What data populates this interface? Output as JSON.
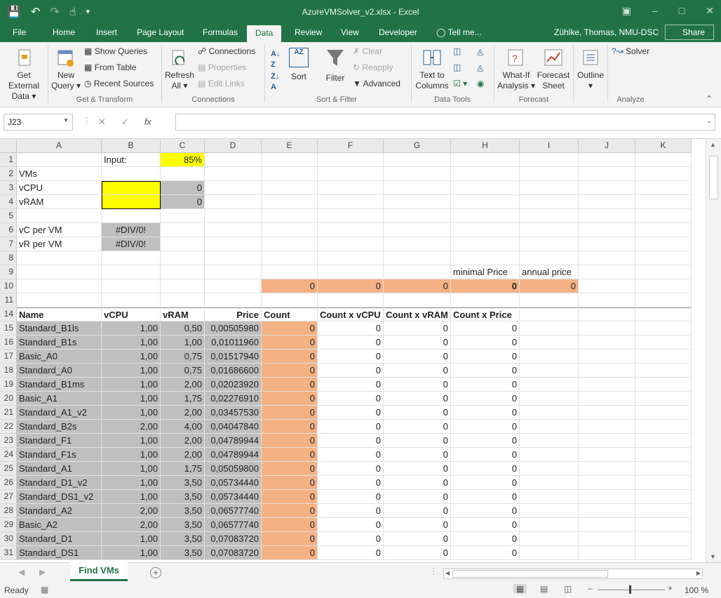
{
  "window": {
    "title": "AzureVMSolver_v2.xlsx - Excel"
  },
  "tabs": [
    "File",
    "Home",
    "Insert",
    "Page Layout",
    "Formulas",
    "Data",
    "Review",
    "View",
    "Developer"
  ],
  "active_tab": "Data",
  "tell_me": "Tell me...",
  "user": "Zühlke, Thomas, NMU-DSC",
  "share": "Share",
  "ribbon": {
    "get_external_data": [
      "Get External",
      "Data"
    ],
    "new_query": [
      "New",
      "Query"
    ],
    "show_queries": "Show Queries",
    "from_table": "From Table",
    "recent_sources": "Recent Sources",
    "refresh_all": [
      "Refresh",
      "All"
    ],
    "connections": "Connections",
    "properties": "Properties",
    "edit_links": "Edit Links",
    "sort_az": "AZ",
    "sort": "Sort",
    "filter": "Filter",
    "clear": "Clear",
    "reapply": "Reapply",
    "advanced": "Advanced",
    "text_to_columns": [
      "Text to",
      "Columns"
    ],
    "what_if": [
      "What-If",
      "Analysis"
    ],
    "forecast_sheet": [
      "Forecast",
      "Sheet"
    ],
    "outline": "Outline",
    "solver": "Solver",
    "groups": [
      "Get & Transform",
      "Connections",
      "Sort & Filter",
      "Data Tools",
      "Forecast",
      "Analyze"
    ]
  },
  "formula_bar": {
    "name_box": "J23",
    "fx": "fx",
    "formula": ""
  },
  "columns": [
    "A",
    "B",
    "C",
    "D",
    "E",
    "F",
    "G",
    "H",
    "I",
    "J",
    "K"
  ],
  "rows_top": [
    {
      "n": "1",
      "B": "Input:",
      "C": "85%"
    },
    {
      "n": "2",
      "A": "VMs"
    },
    {
      "n": "3",
      "A": "vCPU",
      "C": "0"
    },
    {
      "n": "4",
      "A": "vRAM",
      "C": "0"
    },
    {
      "n": "5"
    },
    {
      "n": "6",
      "A": "vC per VM",
      "B": "#DIV/0!"
    },
    {
      "n": "7",
      "A": "vR per VM",
      "B": "#DIV/0!"
    },
    {
      "n": "8"
    },
    {
      "n": "9",
      "H": "minimal Price",
      "I": "annual price"
    },
    {
      "n": "10",
      "E": "0",
      "F": "0",
      "G": "0",
      "H": "0",
      "I": "0"
    },
    {
      "n": "11"
    }
  ],
  "table_header": {
    "n": "14",
    "A": "Name",
    "B": "vCPU",
    "C": "vRAM",
    "D": "Price",
    "E": "Count",
    "F": "Count x vCPU",
    "G": "Count x vRAM",
    "H": "Count x Price"
  },
  "table_rows": [
    {
      "n": "15",
      "name": "Standard_B1ls",
      "vcpu": "1,00",
      "vram": "0,50",
      "price": "0,00505980",
      "count": "0",
      "cv": "0",
      "cr": "0",
      "cp": "0"
    },
    {
      "n": "16",
      "name": "Standard_B1s",
      "vcpu": "1,00",
      "vram": "1,00",
      "price": "0,01011960",
      "count": "0",
      "cv": "0",
      "cr": "0",
      "cp": "0"
    },
    {
      "n": "17",
      "name": "Basic_A0",
      "vcpu": "1,00",
      "vram": "0,75",
      "price": "0,01517940",
      "count": "0",
      "cv": "0",
      "cr": "0",
      "cp": "0"
    },
    {
      "n": "18",
      "name": "Standard_A0",
      "vcpu": "1,00",
      "vram": "0,75",
      "price": "0,01686600",
      "count": "0",
      "cv": "0",
      "cr": "0",
      "cp": "0"
    },
    {
      "n": "19",
      "name": "Standard_B1ms",
      "vcpu": "1,00",
      "vram": "2,00",
      "price": "0,02023920",
      "count": "0",
      "cv": "0",
      "cr": "0",
      "cp": "0"
    },
    {
      "n": "20",
      "name": "Basic_A1",
      "vcpu": "1,00",
      "vram": "1,75",
      "price": "0,02276910",
      "count": "0",
      "cv": "0",
      "cr": "0",
      "cp": "0"
    },
    {
      "n": "21",
      "name": "Standard_A1_v2",
      "vcpu": "1,00",
      "vram": "2,00",
      "price": "0,03457530",
      "count": "0",
      "cv": "0",
      "cr": "0",
      "cp": "0"
    },
    {
      "n": "22",
      "name": "Standard_B2s",
      "vcpu": "2,00",
      "vram": "4,00",
      "price": "0,04047840",
      "count": "0",
      "cv": "0",
      "cr": "0",
      "cp": "0"
    },
    {
      "n": "23",
      "name": "Standard_F1",
      "vcpu": "1,00",
      "vram": "2,00",
      "price": "0,04789944",
      "count": "0",
      "cv": "0",
      "cr": "0",
      "cp": "0"
    },
    {
      "n": "24",
      "name": "Standard_F1s",
      "vcpu": "1,00",
      "vram": "2,00",
      "price": "0,04789944",
      "count": "0",
      "cv": "0",
      "cr": "0",
      "cp": "0"
    },
    {
      "n": "25",
      "name": "Standard_A1",
      "vcpu": "1,00",
      "vram": "1,75",
      "price": "0,05059800",
      "count": "0",
      "cv": "0",
      "cr": "0",
      "cp": "0"
    },
    {
      "n": "26",
      "name": "Standard_D1_v2",
      "vcpu": "1,00",
      "vram": "3,50",
      "price": "0,05734440",
      "count": "0",
      "cv": "0",
      "cr": "0",
      "cp": "0"
    },
    {
      "n": "27",
      "name": "Standard_DS1_v2",
      "vcpu": "1,00",
      "vram": "3,50",
      "price": "0,05734440",
      "count": "0",
      "cv": "0",
      "cr": "0",
      "cp": "0"
    },
    {
      "n": "28",
      "name": "Standard_A2",
      "vcpu": "2,00",
      "vram": "3,50",
      "price": "0,06577740",
      "count": "0",
      "cv": "0",
      "cr": "0",
      "cp": "0"
    },
    {
      "n": "29",
      "name": "Basic_A2",
      "vcpu": "2,00",
      "vram": "3,50",
      "price": "0,06577740",
      "count": "0",
      "cv": "0",
      "cr": "0",
      "cp": "0"
    },
    {
      "n": "30",
      "name": "Standard_D1",
      "vcpu": "1,00",
      "vram": "3,50",
      "price": "0,07083720",
      "count": "0",
      "cv": "0",
      "cr": "0",
      "cp": "0"
    },
    {
      "n": "31",
      "name": "Standard_DS1",
      "vcpu": "1,00",
      "vram": "3,50",
      "price": "0,07083720",
      "count": "0",
      "cv": "0",
      "cr": "0",
      "cp": "0"
    }
  ],
  "sheet_tab": "Find VMs",
  "status": {
    "ready": "Ready",
    "zoom": "100 %"
  },
  "colors": {
    "excel_green": "#217346",
    "gray_fill": "#bfbfbf",
    "orange_fill": "#f4b183",
    "yellow_fill": "#ffff00"
  }
}
